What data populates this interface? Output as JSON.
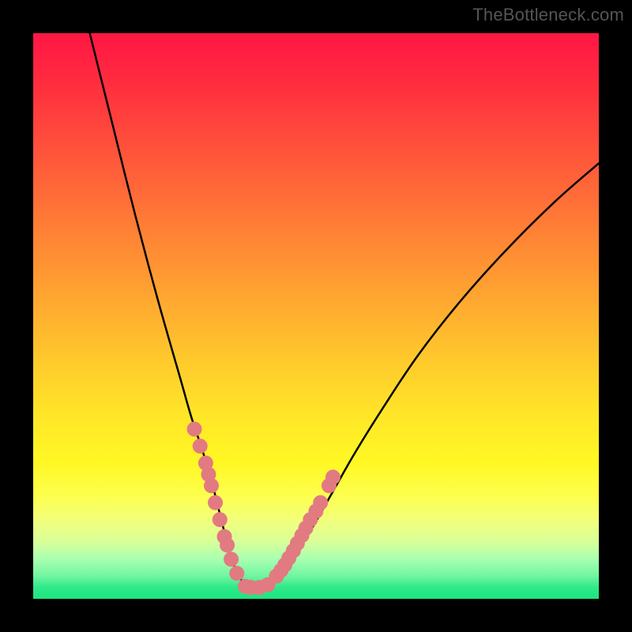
{
  "watermark": "TheBottleneck.com",
  "chart_data": {
    "type": "line",
    "title": "",
    "xlabel": "",
    "ylabel": "",
    "xlim": [
      0,
      100
    ],
    "ylim": [
      0,
      100
    ],
    "grid": false,
    "legend": false,
    "series": [
      {
        "name": "curve",
        "x": [
          10,
          14,
          18,
          22,
          26,
          28,
          30,
          32,
          33,
          34,
          35,
          36,
          37,
          38,
          39,
          40,
          42,
          45,
          49,
          53,
          57,
          62,
          68,
          75,
          83,
          92,
          100
        ],
        "values": [
          100,
          84,
          68,
          53,
          39,
          32,
          26,
          19,
          15,
          11,
          7,
          5,
          3,
          2,
          2,
          2,
          3,
          6,
          12,
          19,
          26,
          34,
          43,
          52,
          61,
          70,
          77
        ]
      }
    ],
    "markers": {
      "name": "points",
      "x": [
        28.5,
        29.5,
        30.5,
        31.0,
        31.5,
        32.2,
        33.0,
        33.8,
        34.3,
        35.0,
        36.0,
        37.5,
        38.5,
        40.0,
        41.5,
        43.0,
        43.8,
        44.5,
        45.2,
        46.0,
        46.7,
        47.5,
        48.2,
        49.0,
        50.0,
        50.8,
        52.3,
        53.0
      ],
      "values": [
        30.0,
        27.0,
        24.0,
        22.0,
        20.0,
        17.0,
        14.0,
        11.0,
        9.5,
        7.0,
        4.5,
        2.2,
        2.0,
        2.0,
        2.5,
        4.0,
        5.0,
        6.0,
        7.2,
        8.5,
        9.8,
        11.2,
        12.5,
        14.0,
        15.5,
        17.0,
        20.0,
        21.5
      ]
    },
    "marker_color": "#e27a82",
    "curve_color": "#000000",
    "background_gradient": [
      "#ff1744",
      "#ff6a38",
      "#ffca2c",
      "#fdff50",
      "#1ce57e"
    ]
  }
}
